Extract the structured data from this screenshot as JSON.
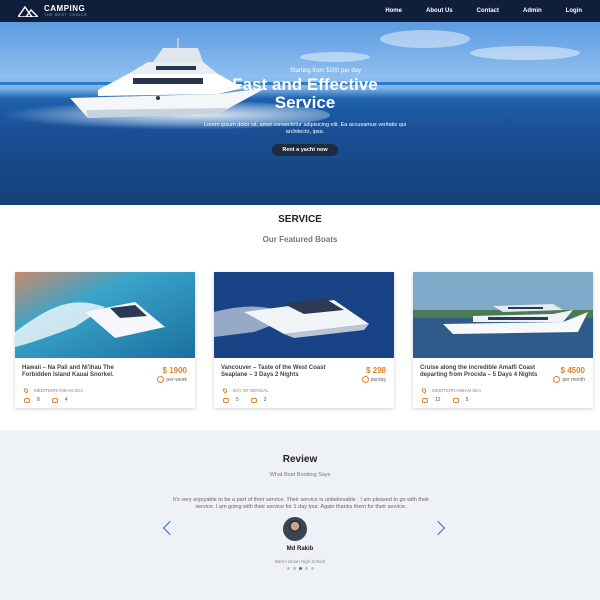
{
  "brand": {
    "name": "CAMPING",
    "tagline": "THE BEST CHOICE"
  },
  "nav": {
    "items": [
      "Home",
      "About Us",
      "Contact",
      "Admin",
      "Login"
    ]
  },
  "hero": {
    "starting": "Starting from $200 per day",
    "title": "Fast and Effective Service",
    "description": "Lorem ipsum dolor sit, amet consectetur adipisicing elit. Ea accusamus veritatis qui architecto, ipsa.",
    "button": "Rent a yacht now"
  },
  "service": {
    "title": "SERVICE",
    "subtitle": "Our Featured Boats"
  },
  "cards": [
    {
      "title": "Hawaii – Na Pali and Ni'ihau The Forbidden Island Kauai Snorkel.",
      "price": "$ 1900",
      "per": "per-week",
      "location": "MEDITERRANEAN SEA",
      "stat1": "8",
      "stat2": "4"
    },
    {
      "title": "Vancouver – Taste of the West Coast Seaplane – 3 Days 2 Nights",
      "price": "$ 298",
      "per": "perday",
      "location": "BAY OF BENGAL",
      "stat1": "5",
      "stat2": "2"
    },
    {
      "title": "Cruise along the incredible Amalfi Coast departing from Procida – 5 Days 4 Nights",
      "price": "$ 4500",
      "per": "per month",
      "location": "MEDITERRANEAN SEA",
      "stat1": "12",
      "stat2": "5"
    }
  ],
  "review": {
    "title": "Review",
    "subtitle": "What Boat Booking Says",
    "text": "It's very enjoyable to be a part of their service. Their service is unbelievable . I am pleased to go with their service. I am going with their service for 1 day tour. Again thanks them for their service.",
    "name": "Md Rakib",
    "school": "Barmi Union High School",
    "active_dot": 2,
    "dot_count": 5
  },
  "colors": {
    "nav_bg": "#0f1e3a",
    "accent": "#e0822a",
    "arrow": "#2a6ad0",
    "review_bg": "#eef1f5"
  }
}
